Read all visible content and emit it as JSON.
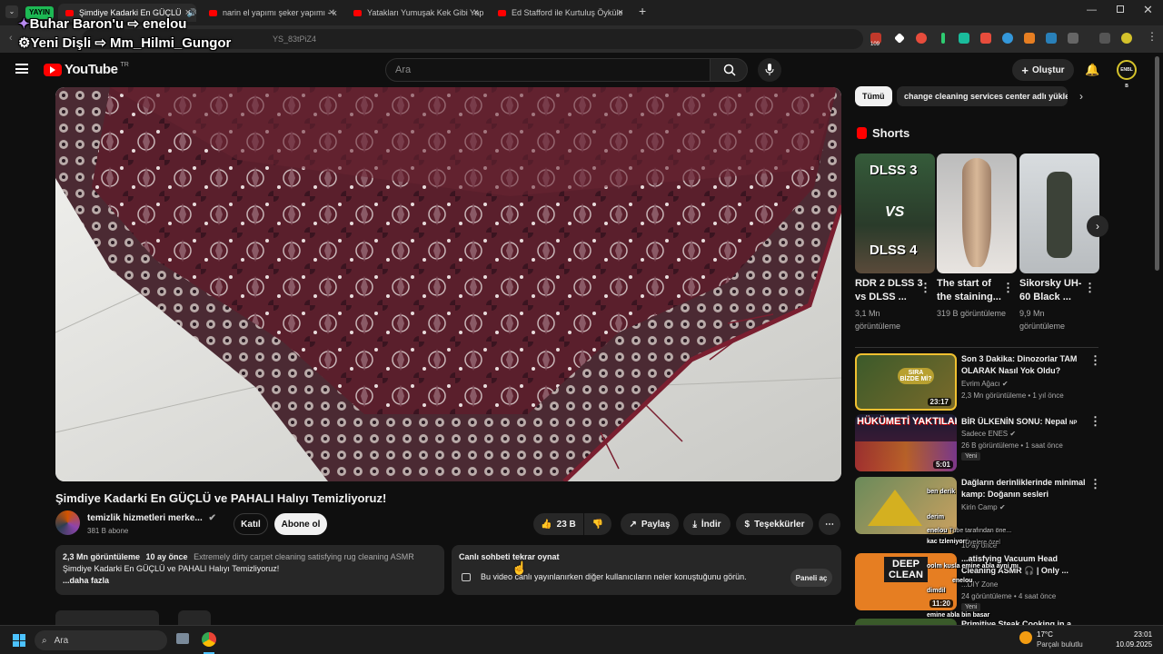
{
  "browser": {
    "live_badge": "YAYIN",
    "tabs": [
      {
        "title": "Şimdiye Kadarki En GÜÇLÜ"
      },
      {
        "title": "narin el yapımı şeker yapımı - k"
      },
      {
        "title": "Yatakları Yumuşak Kek Gibi Yap"
      },
      {
        "title": "Ed Stafford ile Kurtuluş Öyküle"
      }
    ],
    "url_fragment": "YS_83tPiZ4",
    "overlay_line1": "Buhar Baron'u ⇨ enelou",
    "overlay_line2": "Yeni Dişli ⇨ Mm_Hilmi_Gungor",
    "ext_badge": "109"
  },
  "youtube": {
    "logo": "YouTube",
    "region": "TR",
    "search_placeholder": "Ara",
    "create_label": "Oluştur",
    "avatar_text": "ENBL B"
  },
  "video": {
    "title": "Şimdiye Kadarki En GÜÇLÜ ve PAHALI Halıyı Temizliyoruz!",
    "channel_name": "temizlik hizmetleri merke...",
    "subscribers": "381 B abone",
    "join_label": "Katıl",
    "subscribe_label": "Abone ol",
    "likes": "23 B",
    "share_label": "Paylaş",
    "download_label": "İndir",
    "thanks_label": "Teşekkürler"
  },
  "description": {
    "views": "2,3 Mn görüntüleme",
    "age": "10 ay önce",
    "tags": "Extremely dirty carpet cleaning satisfying rug cleaning ASMR",
    "line": "Şimdiye Kadarki En GÜÇLÜ ve PAHALI Halıyı Temizliyoruz!",
    "more": "...daha fazla"
  },
  "chat_replay": {
    "title": "Canlı sohbeti tekrar oynat",
    "text": "Bu video canlı yayınlanırken diğer kullanıcıların neler konuştuğunu görün.",
    "button": "Paneli aç"
  },
  "sidebar": {
    "chips": [
      "Tümü",
      "change cleaning services center adlı yükle"
    ],
    "shorts_heading": "Shorts",
    "shorts": [
      {
        "title": "RDR 2 DLSS 3 vs DLSS ...",
        "views": "3,1 Mn görüntüleme",
        "thumb_top": "DLSS 3",
        "thumb_mid": "VS",
        "thumb_bottom": "DLSS 4"
      },
      {
        "title": "The start of the staining...",
        "views": "319 B görüntüleme"
      },
      {
        "title": "Sikorsky UH-60 Black ...",
        "views": "9,9 Mn görüntüleme"
      }
    ],
    "recommendations": [
      {
        "title": "Son 3 Dakika: Dinozorlar TAM OLARAK Nasıl Yok Oldu?",
        "channel": "Evrim Ağacı",
        "meta": "2,3 Mn görüntüleme • 1 yıl önce",
        "duration": "23:17",
        "thumb_text": "SIRA BİZDE Mİ?"
      },
      {
        "title": "BİR ÜLKENİN SONU: Nepal",
        "channel": "Sadece ENES",
        "meta": "26 B görüntüleme • 1 saat önce",
        "badge": "Yeni",
        "duration": "5:01",
        "thumb_text": "HÜKÜMETİ YAKTILAR",
        "np": "NP"
      },
      {
        "title": "Dağların derinliklerinde minimal kamp: Doğanın sesleri",
        "channel": "Kirin Camp",
        "meta": "10 ay önce"
      },
      {
        "title": "...atisfying Vacuum Head Cleaning ASMR 🎧 | Only ...",
        "channel": "...DIY Zone",
        "meta": "24 görüntüleme • 4 saat önce",
        "badge": "Yeni",
        "duration": "11:20",
        "thumb_text": "DEEP CLEAN"
      },
      {
        "title": "Primitive Steak Cooking in a ..."
      }
    ]
  },
  "chat_overlay": [
    {
      "user": "",
      "text": "ben derik"
    },
    {
      "user": "",
      "text": "derim"
    },
    {
      "user": "enelou",
      "text": "Tube tarafından öne..."
    },
    {
      "user": "",
      "text": "kac tzleniyorr"
    },
    {
      "user": "",
      "text": "Üyelere özel"
    },
    {
      "user": "",
      "text": "oolm kusla emine abla ayni mı"
    },
    {
      "user": "enelou",
      "text": ""
    },
    {
      "user": "",
      "text": "dimdil"
    },
    {
      "user": "",
      "text": "emine abla bin basar"
    }
  ],
  "taskbar": {
    "search_label": "Ara",
    "temp": "17°C",
    "weather": "Parçalı bulutlu",
    "time": "23:01",
    "date": "10.09.2025"
  },
  "colors": {
    "yt_red": "#ff0000",
    "bg": "#0f0f0f",
    "surface": "#272727",
    "live_green": "#1db954"
  }
}
